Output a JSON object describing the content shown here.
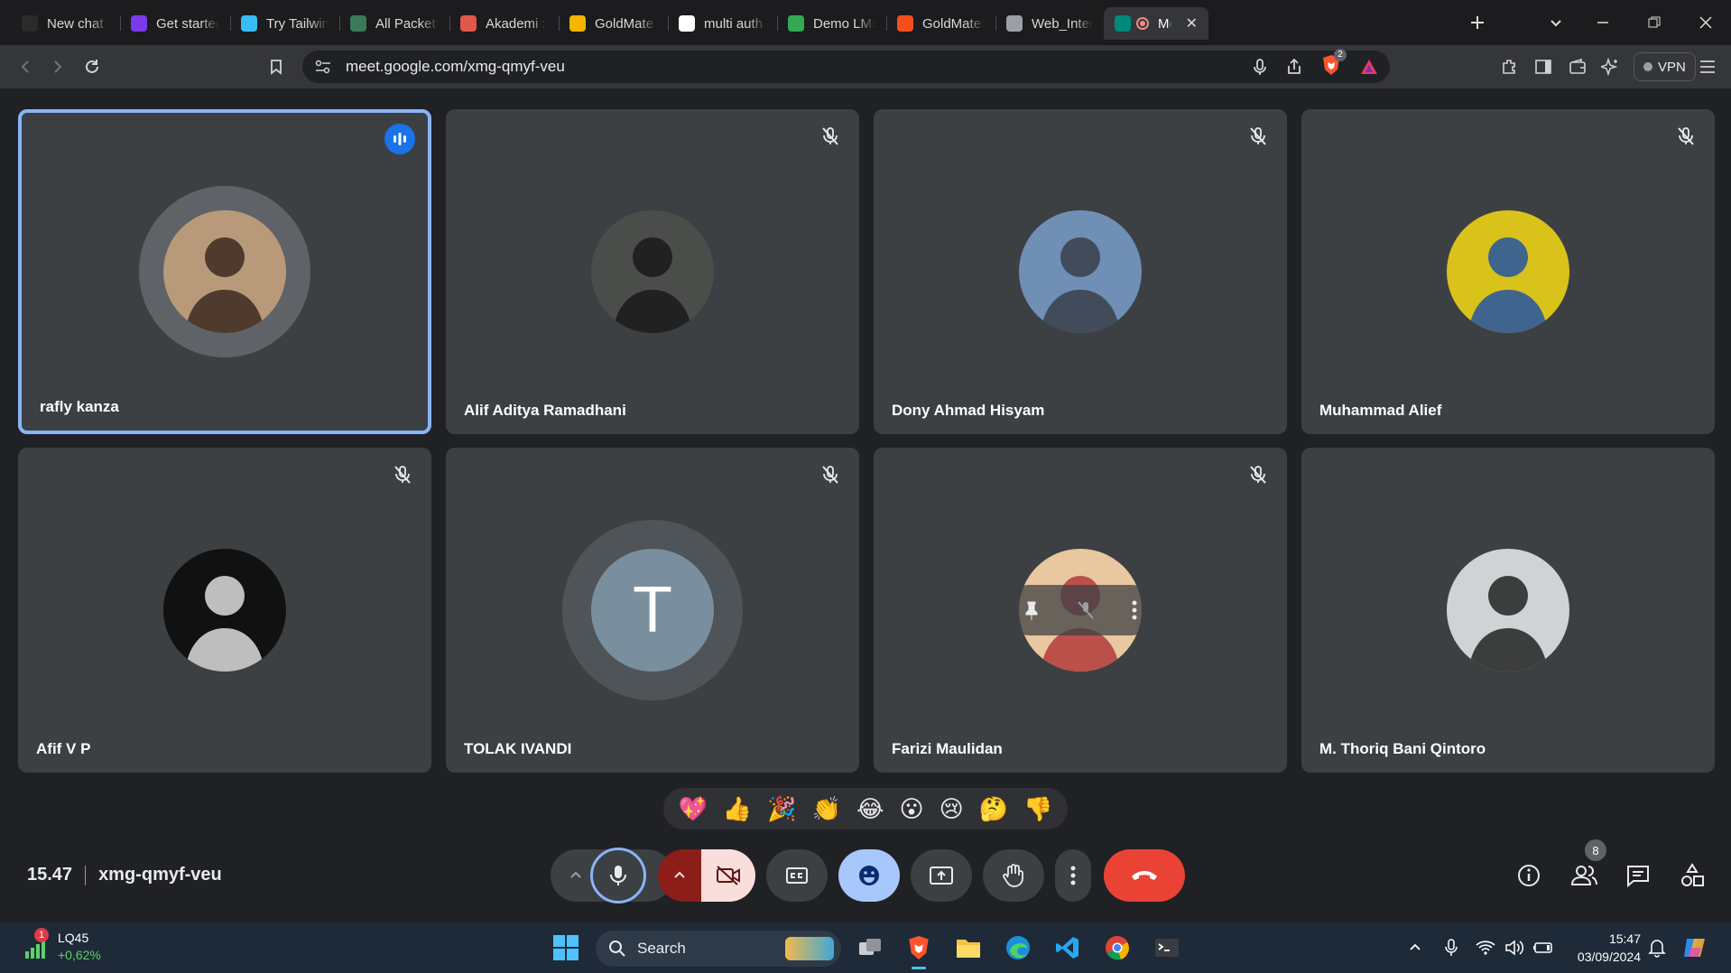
{
  "browser": {
    "tabs": [
      {
        "label": "New chat - P",
        "icon": "chat-icon",
        "color": "#2b2b2b"
      },
      {
        "label": "Get started w",
        "icon": "bootstrap-icon",
        "color": "#7c3aed"
      },
      {
        "label": "Try Tailwind C",
        "icon": "tailwind-icon",
        "color": "#38bdf8"
      },
      {
        "label": "All Packet Te",
        "icon": "packet-icon",
        "color": "#3b7a57"
      },
      {
        "label": "Akademi : Sc",
        "icon": "akademi-icon",
        "color": "#e2574c"
      },
      {
        "label": "GoldMate - C",
        "icon": "drive-icon",
        "color": "#f4b400"
      },
      {
        "label": "multi auth - ",
        "icon": "google-icon",
        "color": "#ffffff"
      },
      {
        "label": "Demo LMS - ",
        "icon": "drive-icon",
        "color": "#34a853"
      },
      {
        "label": "GoldMate: A",
        "icon": "figma-icon",
        "color": "#f24e1e"
      },
      {
        "label": "Web_Interfac",
        "icon": "globe-icon",
        "color": "#9aa0a6"
      },
      {
        "label": "Meet",
        "icon": "meet-icon",
        "color": "#00897b",
        "active": true
      }
    ],
    "url": "meet.google.com/xmg-qmyf-veu",
    "vpn_label": "VPN",
    "shield_count": "2"
  },
  "participants": [
    {
      "name": "rafly kanza",
      "speaking": true,
      "muted": false,
      "avatar": {
        "type": "photo",
        "bg": "#b89a7a",
        "fg": "#3c2a20"
      }
    },
    {
      "name": "Alif Aditya Ramadhani",
      "muted": true,
      "avatar": {
        "type": "photo",
        "bg": "#4a4d4a",
        "fg": "#1a1a1a"
      }
    },
    {
      "name": "Dony Ahmad Hisyam",
      "muted": true,
      "avatar": {
        "type": "photo",
        "bg": "#6f8fb5",
        "fg": "#3a3f4a"
      }
    },
    {
      "name": "Muhammad Alief",
      "muted": true,
      "avatar": {
        "type": "photo",
        "bg": "#d9c21a",
        "fg": "#2355a5"
      }
    },
    {
      "name": "Afif V P",
      "muted": true,
      "avatar": {
        "type": "photo",
        "bg": "#111111",
        "fg": "#dddddd"
      }
    },
    {
      "name": "TOLAK IVANDI",
      "muted": true,
      "avatar": {
        "type": "letter",
        "letter": "T",
        "bg": "#7a8f9e"
      }
    },
    {
      "name": "Farizi Maulidan",
      "muted": true,
      "hover": true,
      "avatar": {
        "type": "photo",
        "bg": "#e9c7a0",
        "fg": "#b33a3a"
      }
    },
    {
      "name": "M. Thoriq Bani Qintoro",
      "muted": false,
      "avatar": {
        "type": "photo",
        "bg": "#cfd3d6",
        "fg": "#222222"
      }
    }
  ],
  "reactions": [
    "💖",
    "👍",
    "🎉",
    "👏",
    "😂",
    "😮",
    "😢",
    "🤔",
    "👎"
  ],
  "meeting": {
    "time": "15.47",
    "code": "xmg-qmyf-veu",
    "people_count": "8"
  },
  "colors": {
    "end_call": "#ea4335",
    "camera_off": "#f9dedc",
    "accent": "#8ab4f8",
    "emoji_active": "#a8c7fa"
  },
  "taskbar": {
    "stock_name": "LQ45",
    "stock_change": "+0,62%",
    "stock_badge": "1",
    "search_label": "Search",
    "time": "15:47",
    "date": "03/09/2024"
  }
}
